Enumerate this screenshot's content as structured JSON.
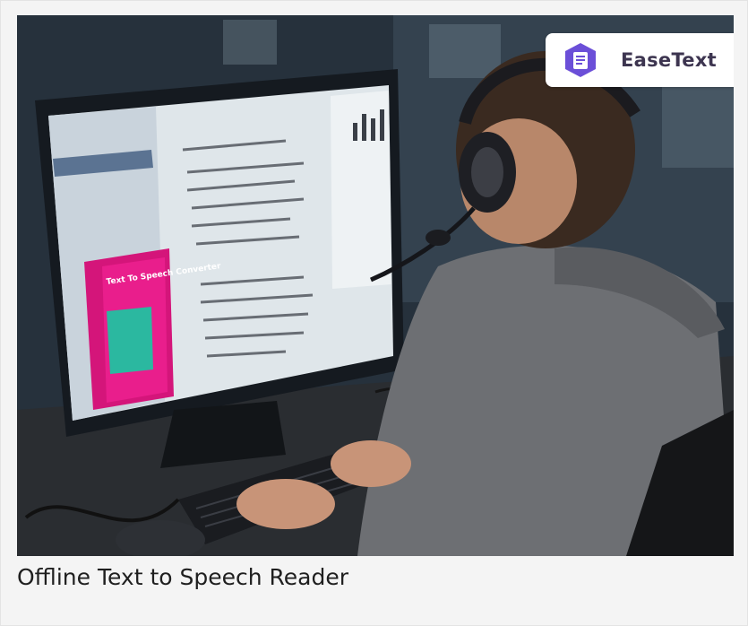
{
  "brand": {
    "name": "EaseText",
    "logo_icon": "easetext-document-hexagon-icon",
    "accent": "#6b4fd8",
    "text_color": "#3d3550"
  },
  "caption": {
    "text": "Offline Text to Speech Reader"
  },
  "illustration": {
    "subject": "person-wearing-headset-at-computer",
    "product_box_title": "Text To Speech Converter",
    "product_box_color": "#d4157a"
  }
}
